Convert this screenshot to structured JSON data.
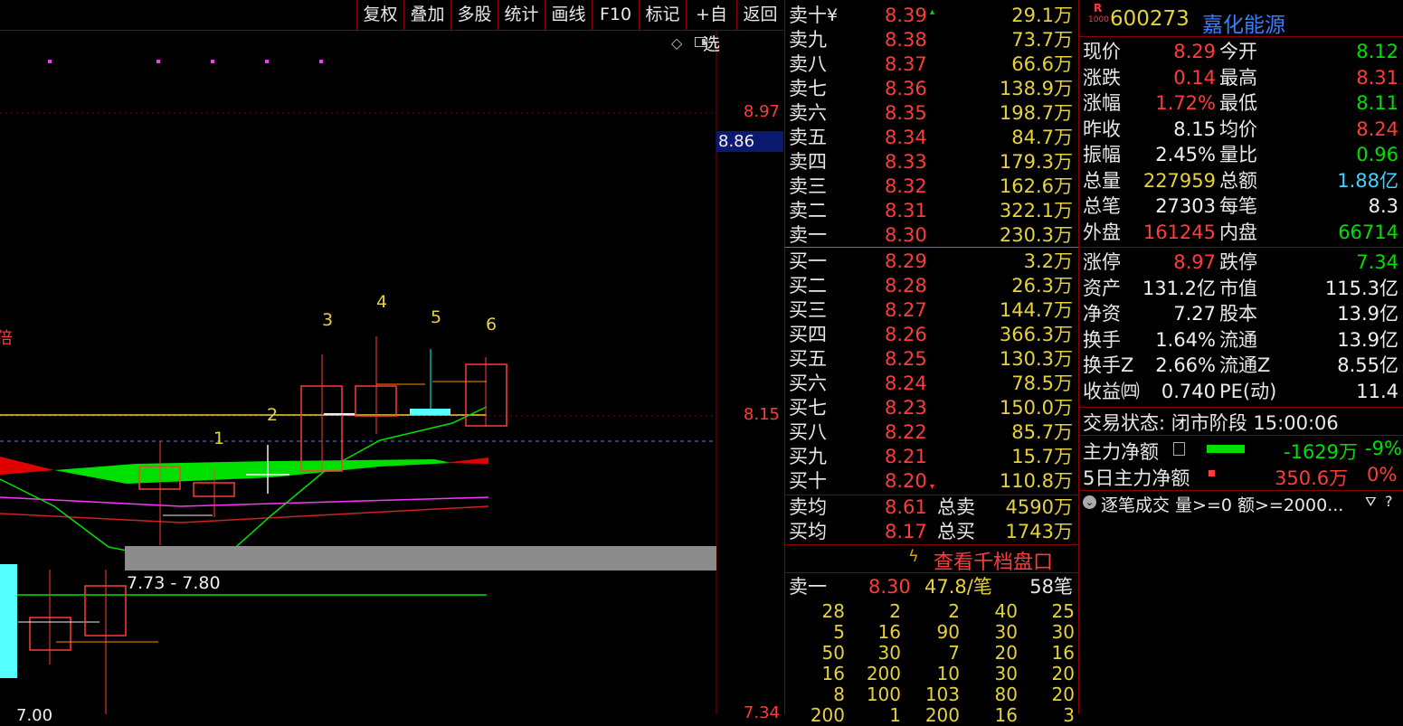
{
  "toolbar": {
    "buttons": [
      "复权",
      "叠加",
      "多股",
      "统计",
      "画线",
      "F10",
      "标记",
      "+自选",
      "返回"
    ]
  },
  "chart": {
    "price_labels": {
      "high": "8.97",
      "mid": "8.15",
      "low": "7.34",
      "cursor": "8.86"
    },
    "candle_numbers": [
      "1",
      "2",
      "3",
      "4",
      "5",
      "6"
    ],
    "range_label": "7.73 - 7.80",
    "left_label": "倍",
    "bottom_left_label": "7.00",
    "colors": {
      "up": "#ff3b3b",
      "down": "#00ffff",
      "ma_yellow": "#e6d23a",
      "ma_green": "#00e000"
    }
  },
  "order_book": {
    "asks": [
      {
        "label": "卖十",
        "price": "8.39",
        "vol": "29.1万"
      },
      {
        "label": "卖九",
        "price": "8.38",
        "vol": "73.7万"
      },
      {
        "label": "卖八",
        "price": "8.37",
        "vol": "66.6万"
      },
      {
        "label": "卖七",
        "price": "8.36",
        "vol": "138.9万"
      },
      {
        "label": "卖六",
        "price": "8.35",
        "vol": "198.7万"
      },
      {
        "label": "卖五",
        "price": "8.34",
        "vol": "84.7万"
      },
      {
        "label": "卖四",
        "price": "8.33",
        "vol": "179.3万"
      },
      {
        "label": "卖三",
        "price": "8.32",
        "vol": "162.6万"
      },
      {
        "label": "卖二",
        "price": "8.31",
        "vol": "322.1万"
      },
      {
        "label": "卖一",
        "price": "8.30",
        "vol": "230.3万"
      }
    ],
    "ask_currency": "¥",
    "bids": [
      {
        "label": "买一",
        "price": "8.29",
        "vol": "3.2万"
      },
      {
        "label": "买二",
        "price": "8.28",
        "vol": "26.3万"
      },
      {
        "label": "买三",
        "price": "8.27",
        "vol": "144.7万"
      },
      {
        "label": "买四",
        "price": "8.26",
        "vol": "366.3万"
      },
      {
        "label": "买五",
        "price": "8.25",
        "vol": "130.3万"
      },
      {
        "label": "买六",
        "price": "8.24",
        "vol": "78.5万"
      },
      {
        "label": "买七",
        "price": "8.23",
        "vol": "150.0万"
      },
      {
        "label": "买八",
        "price": "8.22",
        "vol": "85.7万"
      },
      {
        "label": "买九",
        "price": "8.21",
        "vol": "15.7万"
      },
      {
        "label": "买十",
        "price": "8.20",
        "vol": "110.8万"
      }
    ],
    "avg": [
      {
        "label": "卖均",
        "price": "8.61",
        "label2": "总卖",
        "vol": "4590万"
      },
      {
        "label": "买均",
        "price": "8.17",
        "label2": "总买",
        "vol": "1743万"
      }
    ],
    "thousand_link": "查看千档盘口",
    "level1": {
      "label": "卖一",
      "price": "8.30",
      "per": "47.8/笔",
      "count": "58笔"
    },
    "queue": [
      [
        "28",
        "2",
        "2",
        "40",
        "25"
      ],
      [
        "5",
        "16",
        "90",
        "30",
        "30"
      ],
      [
        "50",
        "30",
        "7",
        "20",
        "16"
      ],
      [
        "16",
        "200",
        "10",
        "30",
        "20"
      ],
      [
        "8",
        "100",
        "103",
        "80",
        "20"
      ],
      [
        "200",
        "1",
        "200",
        "16",
        "3"
      ]
    ]
  },
  "info": {
    "badge": "R",
    "badge_sub": "1000",
    "code": "600273",
    "name": "嘉化能源",
    "rows": [
      {
        "k1": "现价",
        "v1": "8.29",
        "c1": "red",
        "k2": "今开",
        "v2": "8.12",
        "c2": "green"
      },
      {
        "k1": "涨跌",
        "v1": "0.14",
        "c1": "red",
        "k2": "最高",
        "v2": "8.31",
        "c2": "red"
      },
      {
        "k1": "涨幅",
        "v1": "1.72%",
        "c1": "red",
        "k2": "最低",
        "v2": "8.11",
        "c2": "green"
      },
      {
        "k1": "昨收",
        "v1": "8.15",
        "c1": "white",
        "k2": "均价",
        "v2": "8.24",
        "c2": "red"
      },
      {
        "k1": "振幅",
        "v1": "2.45%",
        "c1": "white",
        "k2": "量比",
        "v2": "0.96",
        "c2": "green"
      },
      {
        "k1": "总量",
        "v1": "227959",
        "c1": "yellow",
        "k2": "总额",
        "v2": "1.88亿",
        "c2": "cyan"
      },
      {
        "k1": "总笔",
        "v1": "27303",
        "c1": "white",
        "k2": "每笔",
        "v2": "8.3",
        "c2": "white"
      },
      {
        "k1": "外盘",
        "v1": "161245",
        "c1": "red",
        "k2": "内盘",
        "v2": "66714",
        "c2": "green"
      }
    ],
    "rows2": [
      {
        "k1": "涨停",
        "v1": "8.97",
        "c1": "red",
        "k2": "跌停",
        "v2": "7.34",
        "c2": "green"
      },
      {
        "k1": "资产",
        "v1": "131.2亿",
        "c1": "white",
        "k2": "市值",
        "v2": "115.3亿",
        "c2": "white"
      },
      {
        "k1": "净资",
        "v1": "7.27",
        "c1": "white",
        "k2": "股本",
        "v2": "13.9亿",
        "c2": "white"
      },
      {
        "k1": "换手",
        "v1": "1.64%",
        "c1": "white",
        "k2": "流通",
        "v2": "13.9亿",
        "c2": "white"
      },
      {
        "k1": "换手Z",
        "v1": "2.66%",
        "c1": "white",
        "k2": "流通Z",
        "v2": "8.55亿",
        "c2": "white"
      },
      {
        "k1": "收益㈣",
        "v1": "0.740",
        "c1": "white",
        "k2": "PE(动)",
        "v2": "11.4",
        "c2": "white"
      }
    ],
    "status": "交易状态: 闭市阶段 15:00:06",
    "main_net": {
      "label": "主力净额",
      "value": "-1629万",
      "pct": "-9%"
    },
    "five_day": {
      "label": "5日主力净额",
      "value": "350.6万",
      "pct": "0%"
    },
    "tick_header": "逐笔成交  量>=0 额>=2000..."
  }
}
